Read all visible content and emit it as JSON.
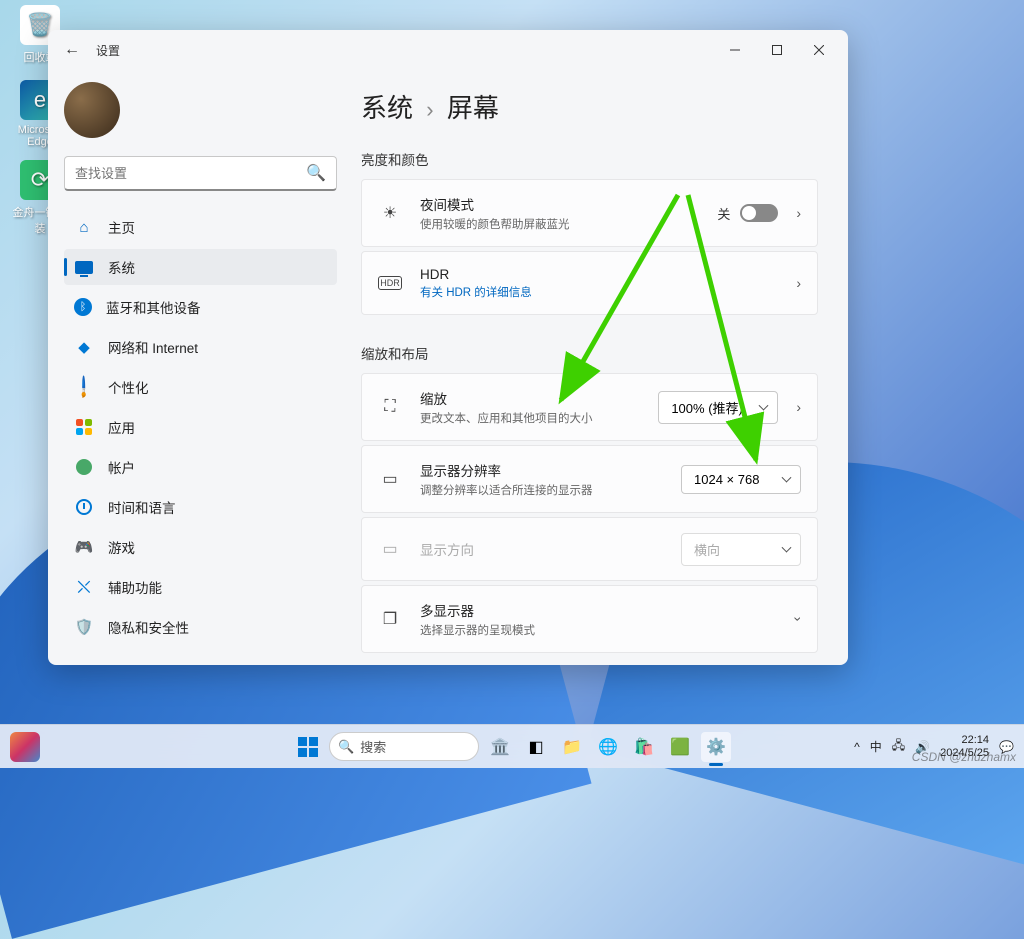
{
  "desktop": {
    "recycle": "回收站",
    "edge": "Microsoft Edge",
    "app": "金舟一键重装"
  },
  "window": {
    "title": "设置",
    "search_placeholder": "查找设置"
  },
  "nav": {
    "home": "主页",
    "system": "系统",
    "bluetooth": "蓝牙和其他设备",
    "network": "网络和 Internet",
    "personalization": "个性化",
    "apps": "应用",
    "accounts": "帐户",
    "time": "时间和语言",
    "gaming": "游戏",
    "accessibility": "辅助功能",
    "privacy": "隐私和安全性"
  },
  "breadcrumb": {
    "parent": "系统",
    "current": "屏幕"
  },
  "sections": {
    "brightness": "亮度和颜色",
    "scale": "缩放和布局"
  },
  "night": {
    "title": "夜间模式",
    "sub": "使用较暖的颜色帮助屏蔽蓝光",
    "state": "关"
  },
  "hdr": {
    "title": "HDR",
    "link": "有关 HDR 的详细信息"
  },
  "scale": {
    "title": "缩放",
    "sub": "更改文本、应用和其他项目的大小",
    "value": "100% (推荐)"
  },
  "resolution": {
    "title": "显示器分辨率",
    "sub": "调整分辨率以适合所连接的显示器",
    "value": "1024 × 768"
  },
  "orientation": {
    "title": "显示方向",
    "value": "横向"
  },
  "multi": {
    "title": "多显示器",
    "sub": "选择显示器的呈现模式"
  },
  "taskbar": {
    "search": "搜索",
    "ime": "中",
    "time": "22:14",
    "date": "2024/5/25"
  },
  "watermark": "CSDN @zhuzhamx"
}
